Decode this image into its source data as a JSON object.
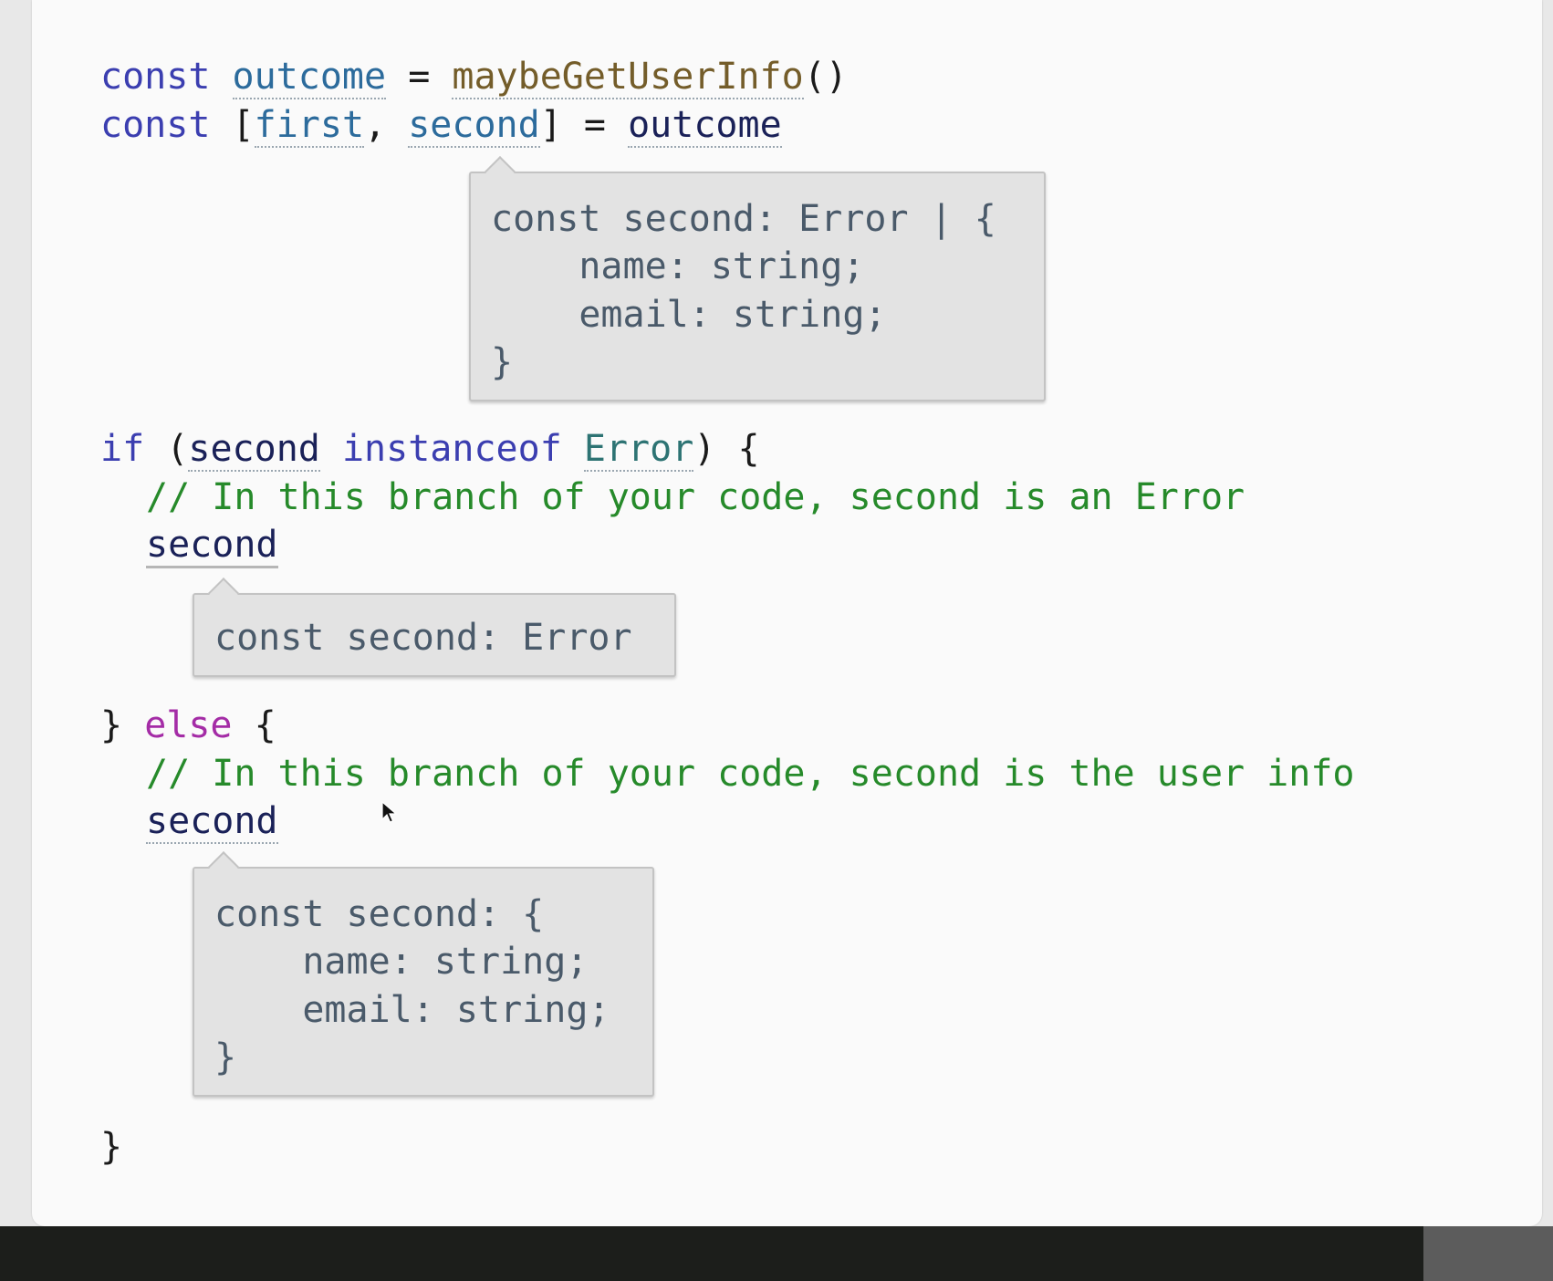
{
  "line1": {
    "kw": "const",
    "var": "outcome",
    "eq": "=",
    "fn": "maybeGetUserInfo",
    "call": "()"
  },
  "line2": {
    "kw": "const",
    "open": "[",
    "first": "first",
    "comma": ",",
    "second": "second",
    "close": "]",
    "eq": "=",
    "outcome": "outcome"
  },
  "tooltip1": {
    "line1": "const second: Error | {",
    "line2": "    name: string;",
    "line3": "    email: string;",
    "line4": "}"
  },
  "if_line": {
    "kw": "if",
    "open": "(",
    "var": "second",
    "op": "instanceof",
    "type": "Error",
    "close": ")",
    "brace": "{"
  },
  "comment1": "// In this branch of your code, second is an Error",
  "second_a": "second",
  "tooltip2": {
    "line1": "const second: Error"
  },
  "else_line": {
    "brace_close": "}",
    "kw": "else",
    "brace_open": "{"
  },
  "comment2": "// In this branch of your code, second is the user info",
  "second_b": "second",
  "tooltip3": {
    "line1": "const second: {",
    "line2": "    name: string;",
    "line3": "    email: string;",
    "line4": "}"
  },
  "end_brace": "}",
  "cursor_icon": "mouse-pointer-icon"
}
